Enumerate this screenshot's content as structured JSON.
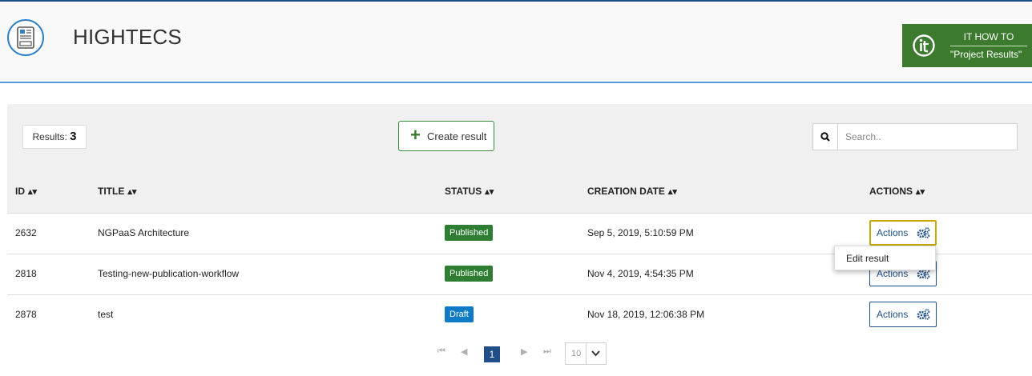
{
  "header": {
    "app_title": "HIGHTECS",
    "howto_line1": "IT HOW TO",
    "howto_line2": "\"Project Results\"",
    "logo_icon": "document-icon",
    "howto_icon": "it-logo-icon"
  },
  "toolbar": {
    "results_label": "Results:",
    "results_count": "3",
    "create_label": "Create result",
    "search_placeholder": "Search..",
    "search_value": ""
  },
  "table": {
    "columns": [
      {
        "label": "ID"
      },
      {
        "label": "TITLE"
      },
      {
        "label": "STATUS"
      },
      {
        "label": "CREATION DATE"
      },
      {
        "label": "ACTIONS"
      }
    ],
    "rows": [
      {
        "id": "2632",
        "title": "NGPaaS Architecture",
        "status": "Published",
        "date": "Sep 5, 2019, 5:10:59 PM",
        "action": "Actions"
      },
      {
        "id": "2818",
        "title": "Testing-new-publication-workflow",
        "status": "Published",
        "date": "Nov 4, 2019, 4:54:35 PM",
        "action": "Actions"
      },
      {
        "id": "2878",
        "title": "test",
        "status": "Draft",
        "date": "Nov 18, 2019, 12:06:38 PM",
        "action": "Actions"
      }
    ]
  },
  "dropdown": {
    "edit_label": "Edit result"
  },
  "pager": {
    "current_page": "1",
    "page_size": "10"
  },
  "colors": {
    "brand_green": "#3c7a2e",
    "brand_blue": "#1f4f86",
    "published": "#2e7d32",
    "draft": "#0f7bc4",
    "focus": "#c9a900"
  }
}
